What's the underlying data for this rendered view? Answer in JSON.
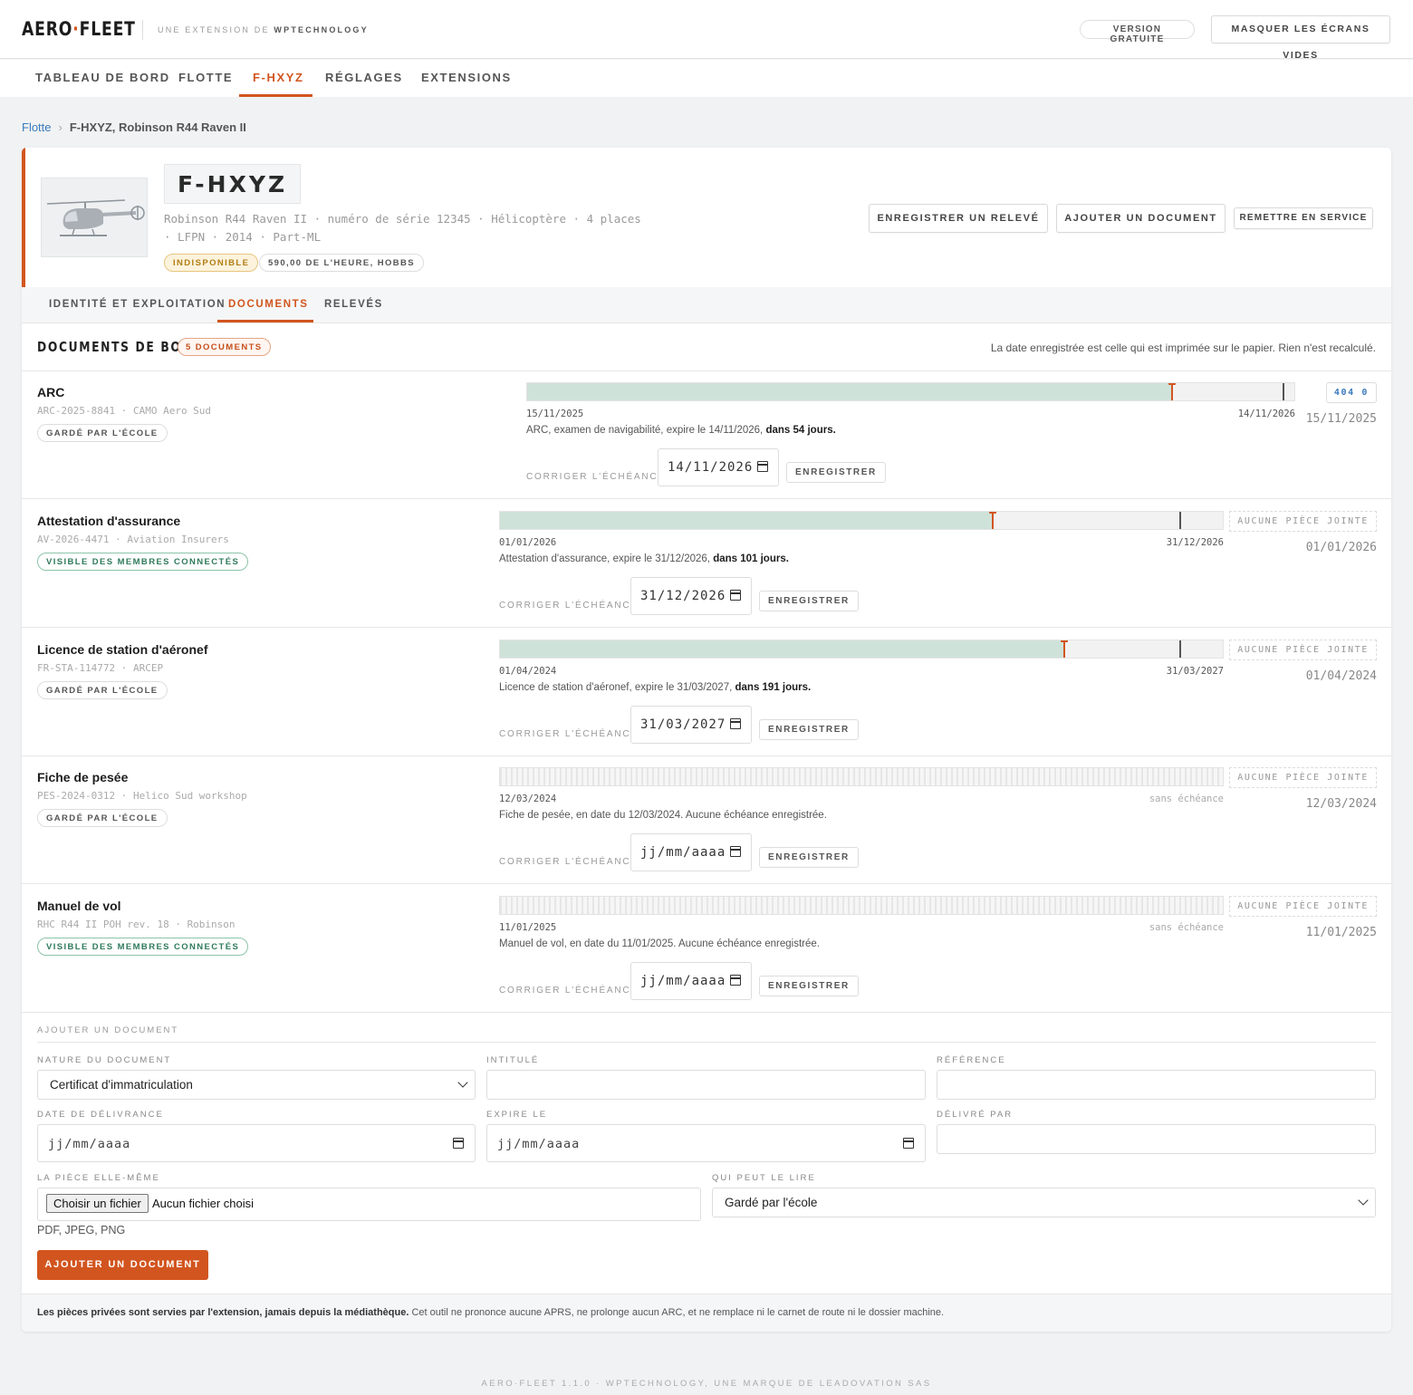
{
  "header": {
    "logo_left": "AERO",
    "logo_dot": "·",
    "logo_right": "FLEET",
    "tagline_prefix": "UNE EXTENSION DE",
    "tagline_brand": "WPTECHNOLOGY",
    "version_badge": "VERSION GRATUITE",
    "hide_empty_button": "MASQUER LES ÉCRANS VIDES"
  },
  "nav": {
    "tabs": [
      "TABLEAU DE BORD",
      "FLOTTE",
      "F-HXYZ",
      "RÉGLAGES",
      "EXTENSIONS"
    ],
    "active": "F-HXYZ"
  },
  "breadcrumb": {
    "root": "Flotte",
    "sep": "›",
    "current": "F-HXYZ, Robinson R44 Raven II"
  },
  "aircraft": {
    "registration": "F-HXYZ",
    "meta_line1": "Robinson R44 Raven II · numéro de série 12345 · Hélicoptère · 4 places",
    "meta_line2": "· LFPN · 2014 · Part-ML",
    "status_badge": "INDISPONIBLE",
    "rate_badge": "590,00 DE L'HEURE, HOBBS",
    "actions": [
      "ENREGISTRER UN RELEVÉ",
      "AJOUTER UN DOCUMENT",
      "REMETTRE EN SERVICE"
    ]
  },
  "subtabs": {
    "items": [
      "IDENTITÉ ET EXPLOITATION",
      "DOCUMENTS",
      "RELEVÉS"
    ],
    "active": "DOCUMENTS"
  },
  "documents": {
    "title": "DOCUMENTS DE BORD",
    "count": "5 DOCUMENTS",
    "note": "La date enregistrée est celle qui est imprimée sur le papier. Rien n'est recalculé.",
    "fix_label": "CORRIGER L'ÉCHÉANCE",
    "save_label": "ENREGISTRER",
    "items": [
      {
        "name": "ARC",
        "ref": "ARC-2025-8841 · CAMO Aero Sud",
        "chip": "GARDÉ PAR L'ÉCOLE",
        "chip_style": "default",
        "start": "15/11/2025",
        "end": "14/11/2026",
        "progress": 0.84,
        "now": 0.84,
        "end_marker": 0.985,
        "text": "ARC, examen de navigabilité, expire le 14/11/2026, ",
        "text_bold": "dans 54 jours.",
        "input_value": "14/11/2026",
        "attachment": "404 0",
        "attachment_is_link": true,
        "right_date": "15/11/2025"
      },
      {
        "name": "Attestation d'assurance",
        "ref": "AV-2026-4471 · Aviation Insurers",
        "chip": "VISIBLE DES MEMBRES CONNECTÉS",
        "chip_style": "green",
        "start": "01/01/2026",
        "end": "31/12/2026",
        "progress": 0.68,
        "now": 0.68,
        "end_marker": 0.94,
        "text": "Attestation d'assurance, expire le 31/12/2026, ",
        "text_bold": "dans 101 jours.",
        "input_value": "31/12/2026",
        "attachment": "AUCUNE PIÈCE JOINTE",
        "attachment_is_link": false,
        "right_date": "01/01/2026"
      },
      {
        "name": "Licence de station d'aéronef",
        "ref": "FR-STA-114772 · ARCEP",
        "chip": "GARDÉ PAR L'ÉCOLE",
        "chip_style": "default",
        "start": "01/04/2024",
        "end": "31/03/2027",
        "progress": 0.78,
        "now": 0.78,
        "end_marker": 0.94,
        "text": "Licence de station d'aéronef, expire le 31/03/2027, ",
        "text_bold": "dans 191 jours.",
        "input_value": "31/03/2027",
        "attachment": "AUCUNE PIÈCE JOINTE",
        "attachment_is_link": false,
        "right_date": "01/04/2024"
      },
      {
        "name": "Fiche de pesée",
        "ref": "PES-2024-0312 · Helico Sud workshop",
        "chip": "GARDÉ PAR L'ÉCOLE",
        "chip_style": "default",
        "start": "12/03/2024",
        "end": "sans échéance",
        "progress": 0,
        "now": null,
        "end_marker": null,
        "text": "Fiche de pesée, en date du 12/03/2024. Aucune échéance enregistrée.",
        "text_bold": "",
        "input_value": "jj/mm/aaaa",
        "attachment": "AUCUNE PIÈCE JOINTE",
        "attachment_is_link": false,
        "right_date": "12/03/2024"
      },
      {
        "name": "Manuel de vol",
        "ref": "RHC R44 II POH rev. 18 · Robinson",
        "chip": "VISIBLE DES MEMBRES CONNECTÉS",
        "chip_style": "green",
        "start": "11/01/2025",
        "end": "sans échéance",
        "progress": 0,
        "now": null,
        "end_marker": null,
        "text": "Manuel de vol, en date du 11/01/2025. Aucune échéance enregistrée.",
        "text_bold": "",
        "input_value": "jj/mm/aaaa",
        "attachment": "AUCUNE PIÈCE JOINTE",
        "attachment_is_link": false,
        "right_date": "11/01/2025"
      }
    ]
  },
  "add_form": {
    "title": "AJOUTER UN DOCUMENT",
    "nature_label": "NATURE DU DOCUMENT",
    "nature_value": "Certificat d'immatriculation",
    "title_label": "INTITULÉ",
    "title_value": "",
    "reference_label": "RÉFÉRENCE",
    "reference_value": "",
    "issue_label": "DATE DE DÉLIVRANCE",
    "issue_value": "jj/mm/aaaa",
    "expires_label": "EXPIRE LE",
    "expires_value": "jj/mm/aaaa",
    "issuer_label": "DÉLIVRÉ PAR",
    "issuer_value": "",
    "file_label": "LA PIÈCE ELLE-MÊME",
    "file_button": "Choisir un fichier",
    "file_none": "Aucun fichier choisi",
    "file_formats": "PDF, JPEG, PNG",
    "visibility_label": "QUI PEUT LE LIRE",
    "visibility_value": "Gardé par l'école",
    "submit": "AJOUTER UN DOCUMENT"
  },
  "footnote": {
    "bold": "Les pièces privées sont servies par l'extension, jamais depuis la médiathèque.",
    "rest": " Cet outil ne prononce aucune APRS, ne prolonge aucun ARC, et ne remplace ni le carnet de route ni le dossier machine."
  },
  "page_footer": "AERO·FLEET 1.1.0 · WPTECHNOLOGY, UNE MARQUE DE LEADOVATION SAS",
  "colors": {
    "accent": "#d2551f",
    "link": "#3a7bbd",
    "bar_fill": "#cfe2d9",
    "warning_bg": "#fdf3dd",
    "green_chip": "#2f7a5c"
  }
}
